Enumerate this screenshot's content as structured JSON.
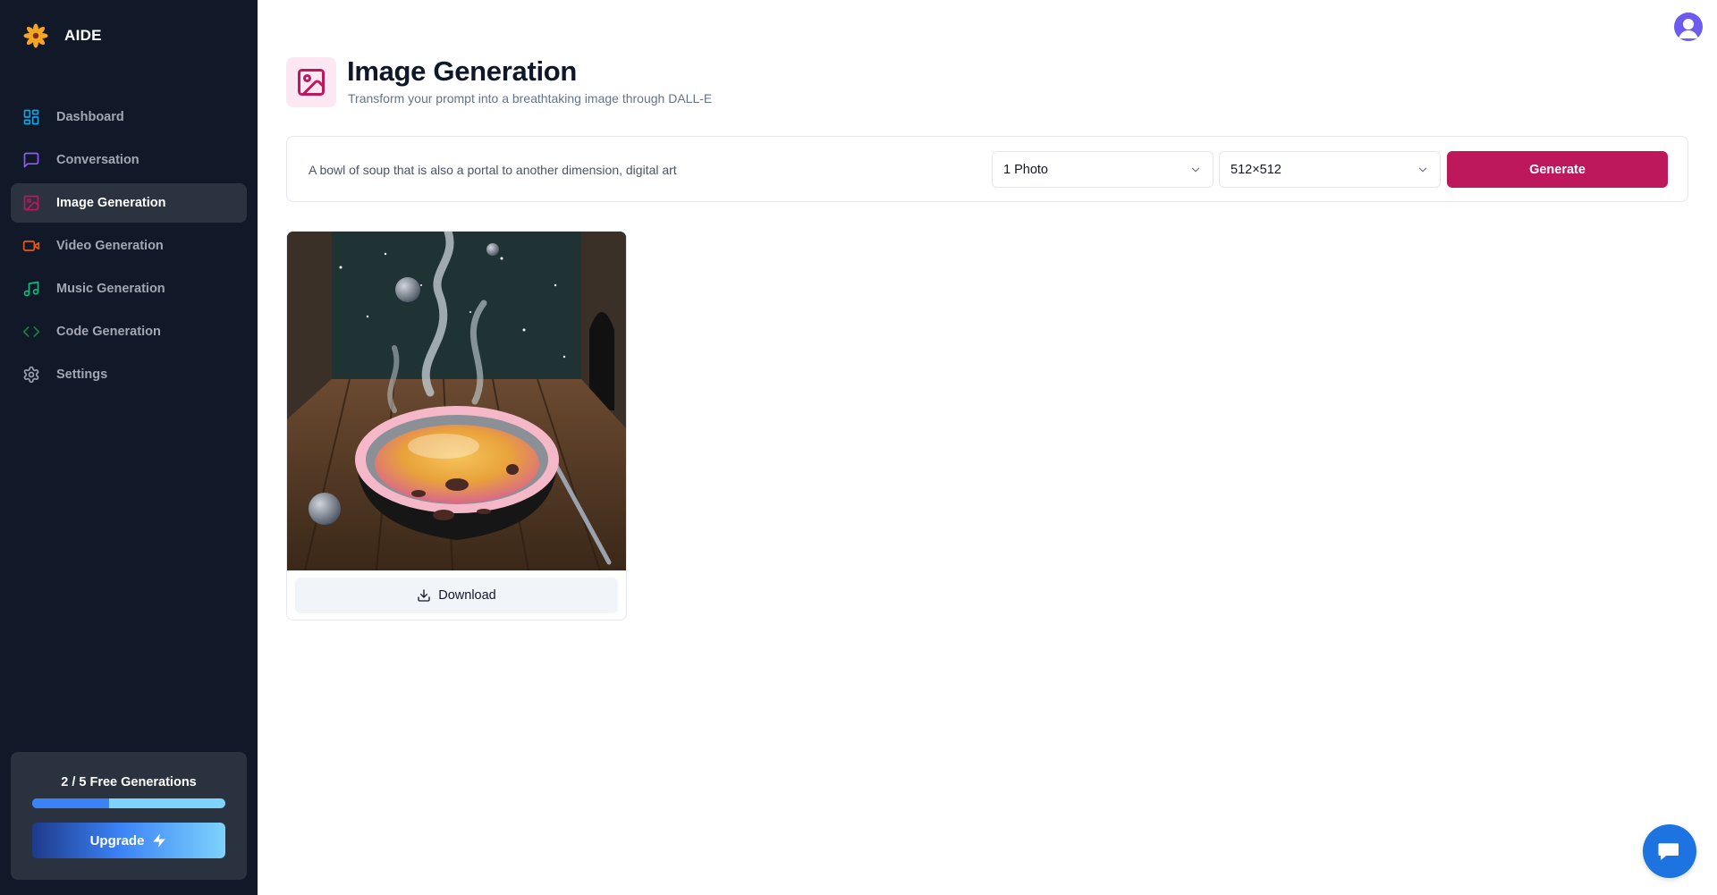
{
  "app": {
    "name": "AIDE",
    "logo_icon": "flower-logo-icon"
  },
  "sidebar": {
    "items": [
      {
        "label": "Dashboard",
        "icon": "layout-dashboard-icon",
        "color": "#0ea5e9",
        "active": false
      },
      {
        "label": "Conversation",
        "icon": "message-square-icon",
        "color": "#8b5cf6",
        "active": false
      },
      {
        "label": "Image Generation",
        "icon": "image-icon",
        "color": "#be185d",
        "active": true
      },
      {
        "label": "Video Generation",
        "icon": "video-icon",
        "color": "#ea580c",
        "active": false
      },
      {
        "label": "Music Generation",
        "icon": "music-icon",
        "color": "#10b981",
        "active": false
      },
      {
        "label": "Code Generation",
        "icon": "code-icon",
        "color": "#15803d",
        "active": false
      },
      {
        "label": "Settings",
        "icon": "settings-gear-icon",
        "color": "#9ca3af",
        "active": false
      }
    ],
    "free_generations": {
      "text": "2 / 5 Free Generations",
      "used": 2,
      "limit": 5
    },
    "upgrade_label": "Upgrade",
    "upgrade_icon": "zap-icon"
  },
  "header": {
    "title": "Image Generation",
    "subtitle": "Transform your prompt into a breathtaking image through DALL-E",
    "icon": "image-icon",
    "icon_color": "#be185d",
    "icon_bg": "#fce7f3"
  },
  "form": {
    "prompt_placeholder": "A bowl of soup that is also a portal to another dimension, digital art",
    "prompt_value": "",
    "amount_selected": "1 Photo",
    "resolution_selected": "512×512",
    "generate_label": "Generate",
    "accent": "#be185d"
  },
  "results": [
    {
      "image_icon": "generated-image",
      "download_label": "Download"
    }
  ],
  "user": {
    "avatar_icon": "user-avatar-icon"
  },
  "support": {
    "icon": "chat-bubble-icon",
    "color": "#1d74e0"
  }
}
